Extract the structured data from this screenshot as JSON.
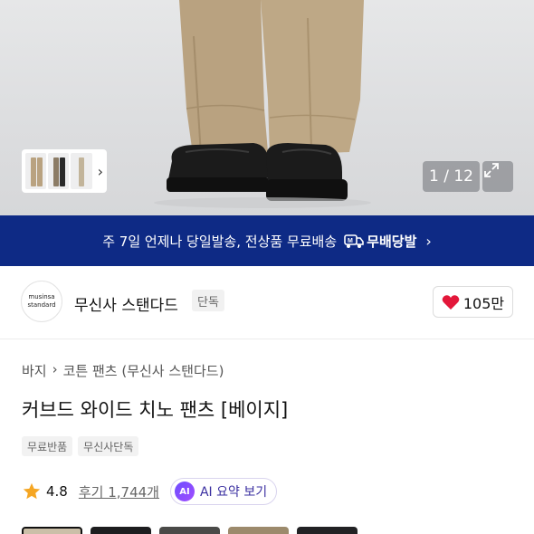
{
  "hero": {
    "image_counter": "1 / 12",
    "thumbnail_chevron": "›",
    "colors": {
      "trousers": "#b9a280",
      "shoes": "#1a1a1a",
      "backdrop": "#dedfe1"
    }
  },
  "banner": {
    "text": "주 7일 언제나 당일발송, 전상품 무료배송",
    "brand_label": "무배당발",
    "chevron": "›",
    "background": "#0e2a85"
  },
  "brand": {
    "logo_line1": "musinsa",
    "logo_line2": "standard",
    "name": "무신사 스탠다드",
    "exclusive_badge": "단독",
    "like_count": "105만"
  },
  "product": {
    "breadcrumb": [
      "바지",
      "코튼 팬츠 (무신사 스탠다드)"
    ],
    "breadcrumb_separator": "›",
    "title": "커브드 와이드 치노 팬츠 [베이지]",
    "tags": [
      "무료반품",
      "무신사단독"
    ],
    "rating": "4.8",
    "review_link": "후기 1,744개",
    "ai_mark": "AI",
    "ai_summary_label": "AI 요약 보기"
  },
  "variants": {
    "colors": [
      "#cbbfa8",
      "#1d1d1f",
      "#4a4a48",
      "#9c8a6c",
      "#222224"
    ]
  }
}
